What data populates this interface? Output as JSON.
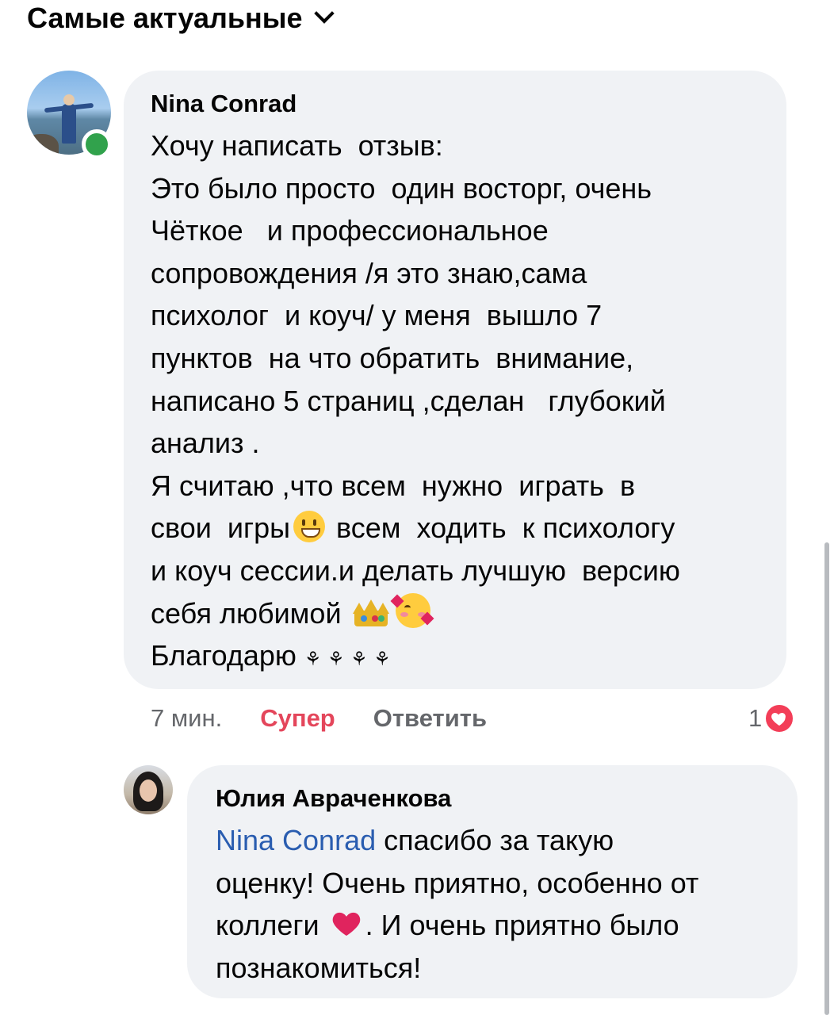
{
  "header": {
    "sort_label": "Самые актуальные"
  },
  "comment": {
    "author": "Nina Conrad",
    "text_lines": {
      "l1": "Хочу написать  отзыв:",
      "l2": "Это было просто  один восторг, очень",
      "l3": "Чёткое   и профессиональное",
      "l4": "сопровождения /я это знаю,сама",
      "l5": "психолог  и коуч/ у меня  вышло 7",
      "l6": "пунктов  на что обратить  внимание,",
      "l7": "написано 5 страниц ,сделан   глубокий",
      "l8": "анализ .",
      "l9": "Я считаю ,что всем  нужно  играть  в",
      "l10a": "свои  игры",
      "l10b": " всем  ходить  к психологу",
      "l11": "и коуч сессии.и делать лучшую  версию",
      "l12": "себя любимой ",
      "l13": "Благодарю ",
      "flowers": "⚘ ⚘ ⚘ ⚘"
    },
    "time": "7 мин.",
    "react_label": "Супер",
    "reply_label": "Ответить",
    "reaction_count": "1",
    "online": true
  },
  "reply": {
    "author": "Юлия Авраченкова",
    "mention": "Nina Conrad",
    "line1_rest": " спасибо за такую",
    "line2": "оценку! Очень приятно, особенно от",
    "line3a": "коллеги ",
    "line3b": ". И очень приятно было",
    "line4": "познакомиться!"
  },
  "icons": {
    "sort": "chevron-down-icon",
    "emoji_grin": "grinning-face-emoji",
    "emoji_crown": "crown-emoji",
    "emoji_love": "smiling-face-with-hearts-emoji",
    "emoji_heart": "red-heart-emoji",
    "reaction": "love-reaction-icon"
  },
  "colors": {
    "bubble": "#f0f2f5",
    "react_active": "#e4465b",
    "mention": "#2a5db0",
    "online": "#31a24c",
    "love": "#f33e58"
  }
}
